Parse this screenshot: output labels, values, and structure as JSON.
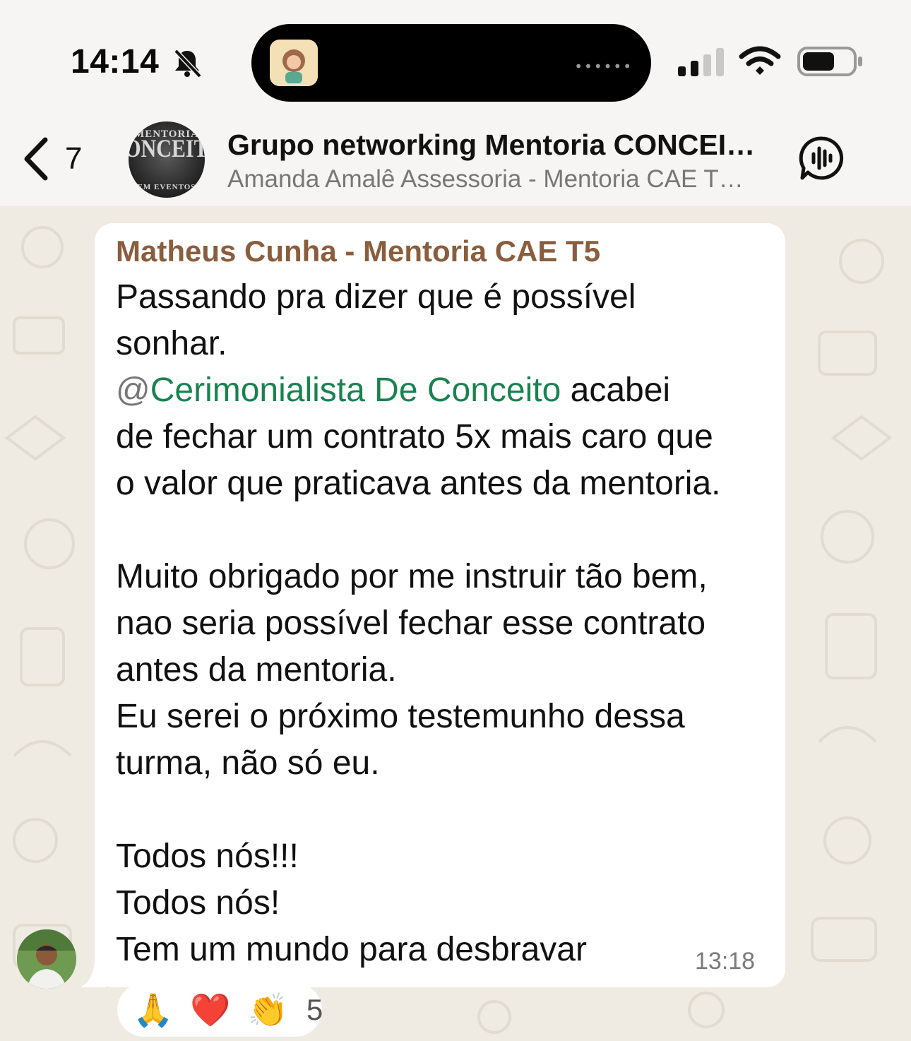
{
  "status_bar": {
    "time": "14:14",
    "icons": [
      "bell-slash-icon",
      "signal-icon",
      "wifi-icon",
      "battery-icon"
    ]
  },
  "header": {
    "back_count": "7",
    "title": "Grupo networking Mentoria CONCEI…",
    "subtitle": "Amanda Amalê Assessoria - Mentoria CAE T…",
    "avatar_text": [
      "MENTORIA",
      "CONCEITO A",
      "EM EVENTOS"
    ],
    "call_icon": "audio-call-icon"
  },
  "message": {
    "sender": "Matheus Cunha - Mentoria CAE T5",
    "line1": "Passando pra dizer que é possível",
    "line2": "sonhar.",
    "mention_at": "@",
    "mention_name": "Cerimonialista De Conceito",
    "line3_rest": " acabei",
    "line4": "de fechar um contrato 5x mais caro que",
    "line5": "o valor que praticava antes da mentoria.",
    "line6": "Muito obrigado por me instruir tão bem,",
    "line7": "nao seria possível fechar esse contrato",
    "line8": "antes da mentoria.",
    "line9": "Eu serei o próximo testemunho dessa",
    "line10": "turma, não só eu.",
    "line11": "Todos nós!!!",
    "line12": "Todos nós!",
    "line13": "Tem um mundo para desbravar",
    "time": "13:18"
  },
  "reactions": {
    "emojis": [
      "🙏",
      "❤️",
      "👏"
    ],
    "count": "5"
  },
  "colors": {
    "sender_name": "#8a5d3c",
    "mention": "#1a8250",
    "background": "#efeae2",
    "bubble": "#ffffff"
  }
}
